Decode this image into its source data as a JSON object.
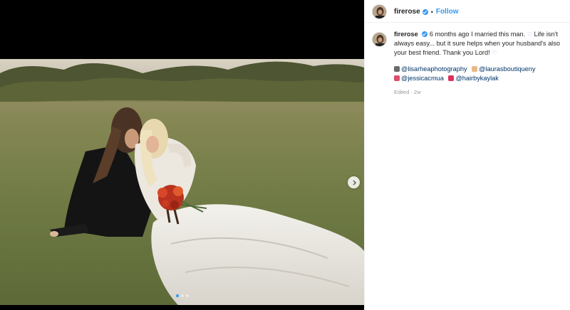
{
  "post": {
    "username": "firerose",
    "header_separator": "•",
    "follow_label": "Follow",
    "verified_icon": "verified-badge-icon"
  },
  "caption": {
    "username": "firerose",
    "text": "6 months ago I married this man.",
    "heart1": "♡",
    "text2": "Life isn't always easy... but it sure helps when your husband's also your best friend. Thank you Lord!",
    "heart2": "♡"
  },
  "credits": [
    {
      "emoji": "camera-emoji",
      "emoji_color": "#6b6b6b",
      "handle": "@lisarheaphotography"
    },
    {
      "emoji": "bride-emoji",
      "emoji_color": "#e8b98a",
      "handle": "@laurasboutiqueny"
    },
    {
      "emoji": "lipstick-emoji",
      "emoji_color": "#d8506a",
      "handle": "@jessicacmua"
    },
    {
      "emoji": "bow-emoji",
      "emoji_color": "#e0305a",
      "handle": "@hairbykaylak"
    }
  ],
  "edited_label": "Edited · 2w",
  "carousel": {
    "slide_count": 3,
    "active_index": 0
  },
  "colors": {
    "accent": "#3897f0",
    "mention": "#003569",
    "muted": "#999999"
  }
}
